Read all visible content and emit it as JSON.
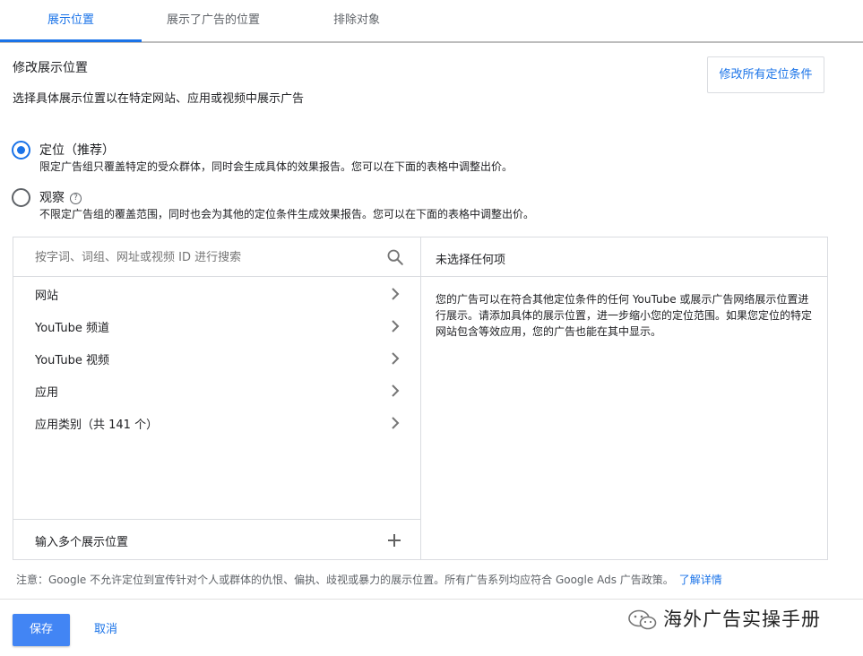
{
  "tabs": [
    {
      "label": "展示位置"
    },
    {
      "label": "展示了广告的位置"
    },
    {
      "label": "排除对象"
    }
  ],
  "header": {
    "title": "修改展示位置",
    "subtitle": "选择具体展示位置以在特定网站、应用或视频中展示广告",
    "edit_all_label": "修改所有定位条件"
  },
  "options": [
    {
      "label": "定位（推荐）",
      "description": "限定广告组只覆盖特定的受众群体，同时会生成具体的效果报告。您可以在下面的表格中调整出价。",
      "checked": true
    },
    {
      "label": "观察",
      "description": "不限定广告组的覆盖范围，同时也会为其他的定位条件生成效果报告。您可以在下面的表格中调整出价。",
      "checked": false,
      "help_icon": "?"
    }
  ],
  "search": {
    "placeholder": "按字词、词组、网址或视频 ID 进行搜索",
    "value": ""
  },
  "categories": [
    {
      "label": "网站"
    },
    {
      "label": "YouTube 频道"
    },
    {
      "label": "YouTube 视频"
    },
    {
      "label": "应用"
    },
    {
      "label": "应用类别（共 141 个）"
    }
  ],
  "multi_placements_label": "输入多个展示位置",
  "selection": {
    "title": "未选择任何项",
    "body": "您的广告可以在符合其他定位条件的任何 YouTube 或展示广告网络展示位置进行展示。请添加具体的展示位置，进一步缩小您的定位范围。如果您定位的特定网站包含等效应用，您的广告也能在其中显示。"
  },
  "notice": {
    "text": "注意：Google 不允许定位到宣传针对个人或群体的仇恨、偏执、歧视或暴力的展示位置。所有广告系列均应符合 Google Ads 广告政策。",
    "link": "了解详情"
  },
  "footer": {
    "save_label": "保存",
    "cancel_label": "取消"
  },
  "watermark": {
    "text": "海外广告实操手册"
  },
  "colors": {
    "accent": "#1a73e8",
    "save_button": "#4285f4",
    "border": "#dadce0"
  }
}
